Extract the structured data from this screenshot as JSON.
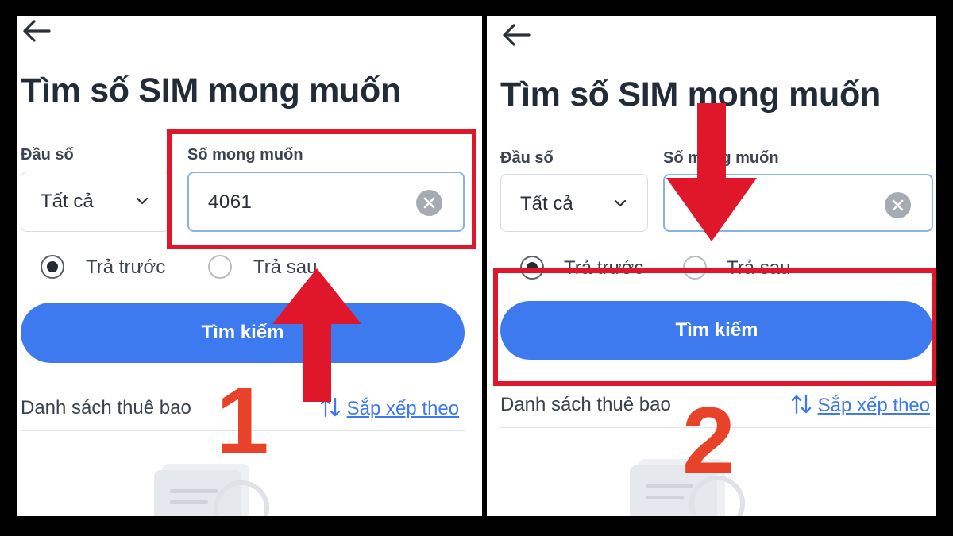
{
  "panels": [
    {
      "title": "Tìm số SIM mong muốn",
      "prefix_label": "Đầu số",
      "prefix_value": "Tất cả",
      "desired_label": "Số mong muốn",
      "desired_value": "4061",
      "radio_prepaid": "Trả trước",
      "radio_postpaid": "Trả sau",
      "search_button": "Tìm kiếm",
      "list_title": "Danh sách thuê bao",
      "sort_label": "Sắp xếp theo",
      "step_number": "1"
    },
    {
      "title": "Tìm số SIM mong muốn",
      "prefix_label": "Đầu số",
      "prefix_value": "Tất cả",
      "desired_label": "Số mong muốn",
      "desired_value": "",
      "radio_prepaid": "Trả trước",
      "radio_postpaid": "Trả sau",
      "search_button": "Tìm kiếm",
      "list_title": "Danh sách thuê bao",
      "sort_label": "Sắp xếp theo",
      "step_number": "2"
    }
  ],
  "colors": {
    "accent": "#3d79ef",
    "highlight": "#e0172a",
    "step_number": "#e8432a",
    "background": "#000000"
  },
  "icons": [
    "back-arrow-icon",
    "chevron-down-icon",
    "clear-icon",
    "sort-icon",
    "empty-list-icon"
  ]
}
